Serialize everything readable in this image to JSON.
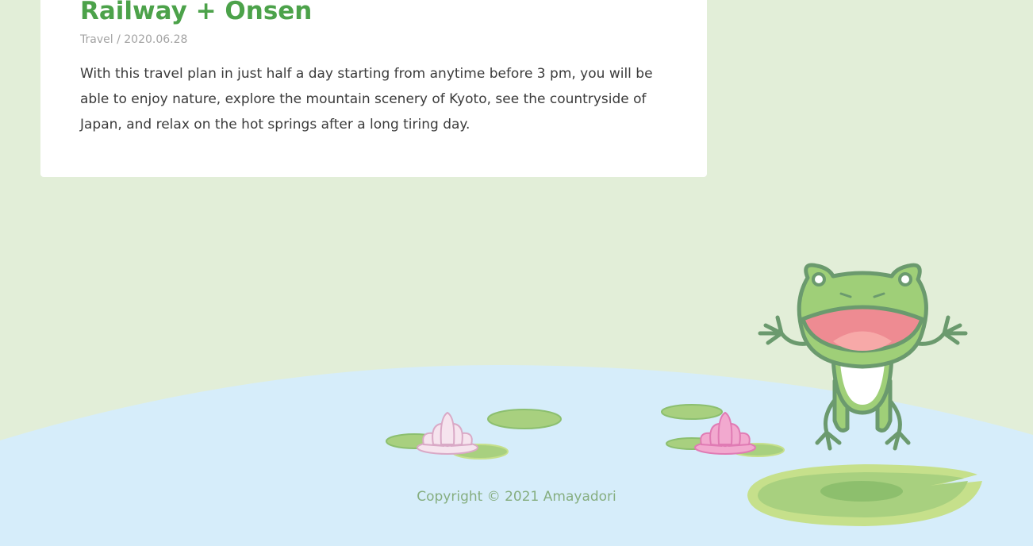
{
  "post": {
    "title": "Railway + Onsen",
    "category": "Travel",
    "separator": " / ",
    "date": "2020.06.28",
    "excerpt": "With this travel plan in just half a day starting from anytime before 3 pm, you will be able to enjoy nature, explore the mountain scenery of Kyoto, see the countryside of Japan, and relax on the hot springs after a long tiring day."
  },
  "footer": {
    "copyright": "Copyright © 2021 Amayadori"
  },
  "colors": {
    "background": "#e2eed8",
    "pond": "#d6edfa",
    "title_green": "#4ca24a",
    "lily_pad": "#a8d07f",
    "frog_green": "#9fcf78",
    "frog_outline": "#6b9a6e",
    "lotus_pink": "#f2a9cf",
    "lotus_white": "#f6e4ee",
    "copyright_green": "#86ae80"
  },
  "illustrations": [
    "pond",
    "lily-pads",
    "lotus-flowers",
    "frog"
  ]
}
